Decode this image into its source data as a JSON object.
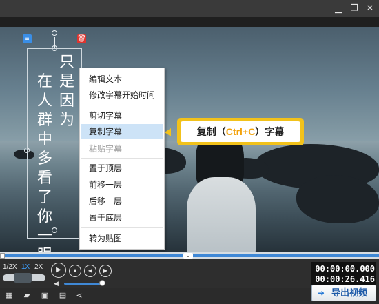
{
  "window": {
    "minimize_icon": "minimize-icon",
    "maximize_icon": "restore-icon",
    "close_icon": "close-icon"
  },
  "subtitle": {
    "column_1": "只是因为",
    "column_2": "在人群中多看了你一眼"
  },
  "context_menu": {
    "items": [
      {
        "label": "编辑文本",
        "state": "normal"
      },
      {
        "label": "修改字幕开始时间",
        "state": "normal"
      },
      {
        "label": "剪切字幕",
        "state": "normal"
      },
      {
        "label": "复制字幕",
        "state": "active"
      },
      {
        "label": "粘贴字幕",
        "state": "disabled"
      },
      {
        "label": "置于顶层",
        "state": "normal"
      },
      {
        "label": "前移一层",
        "state": "normal"
      },
      {
        "label": "后移一层",
        "state": "normal"
      },
      {
        "label": "置于底层",
        "state": "normal"
      },
      {
        "label": "转为贴图",
        "state": "normal"
      }
    ]
  },
  "callout": {
    "prefix": "复制（",
    "shortcut": "Ctrl+C",
    "suffix": "）字幕"
  },
  "playback": {
    "speeds": [
      "1/2X",
      "1X",
      "2X"
    ],
    "selected_speed": "1X",
    "current_time": "00:00:00.000",
    "total_time": "00:00:26.416"
  },
  "toolbar": {
    "export_label": "导出视频"
  },
  "colors": {
    "accent": "#3f88d6",
    "callout": "#f2c21b",
    "highlight_text": "#f2a20c"
  }
}
